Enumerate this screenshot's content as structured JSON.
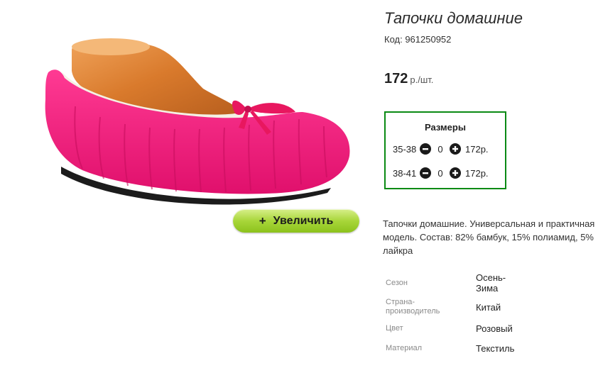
{
  "product": {
    "title": "Тапочки домашние",
    "code_label": "Код: 961250952",
    "price": "172",
    "price_unit": "р./шт.",
    "image_icon": "slipper-product-image",
    "zoom_button": "Увеличить",
    "zoom_icon": "+"
  },
  "sizes": {
    "title": "Размеры",
    "rows": [
      {
        "size": "35-38",
        "qty": "0",
        "price": "172р."
      },
      {
        "size": "38-41",
        "qty": "0",
        "price": "172р."
      }
    ]
  },
  "description": "Тапочки домашние. Универсальная и практичная модель. Состав: 82% бамбук, 15% полиамид, 5% лайкра",
  "specs": [
    {
      "label": "Сезон",
      "value": "Осень-Зима"
    },
    {
      "label": "Страна-производитель",
      "value": "Китай"
    },
    {
      "label": "Цвет",
      "value": "Розовый"
    },
    {
      "label": "Материал",
      "value": "Текстиль"
    }
  ],
  "colors": {
    "accent_border": "#0a8a14",
    "button_green": "#a8d63a",
    "slipper_pink": "#f0237e"
  }
}
